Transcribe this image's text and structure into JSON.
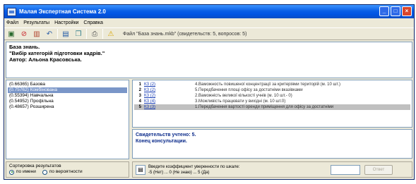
{
  "window": {
    "title": "Малая Экспертная Система 2.0"
  },
  "menu": [
    "Файл",
    "Результаты",
    "Настройки",
    "Справка"
  ],
  "toolbar": {
    "icons": [
      "new-icon",
      "stop-icon",
      "chart-icon",
      "undo-icon",
      "save-icon",
      "copy-icon",
      "print-icon",
      "warning-icon"
    ],
    "kb_file": "Файл \"База знань.mkb\" (свидетельств: 5, вопросов: 5)"
  },
  "header": {
    "line1": "База знань.",
    "line2": "\"Вибір категорій підготовки кадрів.\"",
    "line3": "Автор: Альона Красовська."
  },
  "categories": [
    {
      "score": "(0.66365)",
      "name": "Базова",
      "selected": false
    },
    {
      "score": "(0.75762)",
      "name": "Комбінована",
      "selected": true
    },
    {
      "score": "(0.55394)",
      "name": "Навчальна",
      "selected": false
    },
    {
      "score": "(0.54952)",
      "name": "Профільна",
      "selected": false
    },
    {
      "score": "(0.48657)",
      "name": "Розширена",
      "selected": false
    }
  ],
  "questions": [
    {
      "num": "1",
      "link": "КЗ (2)",
      "text": "4.Ваможность повишеної концентрації за критеріями територій (м. 10 шт.)",
      "selected": false
    },
    {
      "num": "2",
      "link": "КЗ (2)",
      "text": "5.Передбачення площі офісу за достатніми вказівками",
      "selected": false
    },
    {
      "num": "3",
      "link": "КЗ (2)",
      "text": "2.Ваможність великої кількості учнів (м. 10 шт.- 0)",
      "selected": false
    },
    {
      "num": "4",
      "link": "КЗ (4)",
      "text": "3.Можливість працювати у вихідні (м. 10 шт.0)",
      "selected": false
    },
    {
      "num": "5",
      "link": "КЗ (3)",
      "text": "1.Передбачення вартості оренди приміщення для офісу за достатніми",
      "selected": true
    }
  ],
  "result": {
    "line1": "Свидетельств учтено: 5.",
    "line2": "Конец консультации."
  },
  "sort": {
    "title": "Сортировка результатов",
    "option1": "по имени",
    "option2": "по вероятности",
    "selected": "option1"
  },
  "answer": {
    "hint_line1": "Введите коэффициент уверенности по шкале:",
    "hint_line2": "-5 (Нет) ... 0 (Не знаю) ... 5 (Да)",
    "ok_label": "Ответ"
  }
}
